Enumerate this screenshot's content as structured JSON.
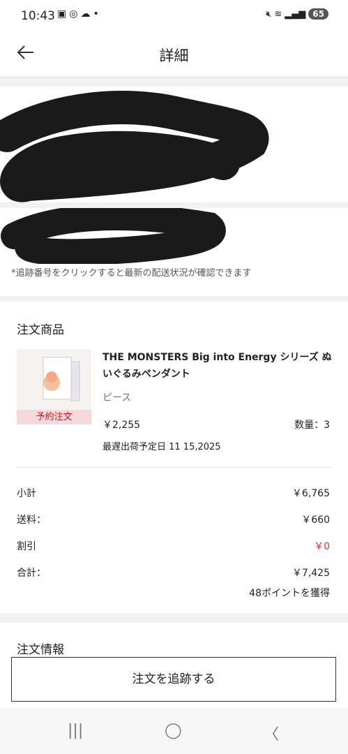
{
  "status_bar": {
    "time": "10:43",
    "battery": "65"
  },
  "header": {
    "title": "詳細"
  },
  "tracking_note": "*追跡番号をクリックすると最新の配送状況が確認できます",
  "order_items": {
    "section_title": "注文商品",
    "product": {
      "name": "THE MONSTERS Big into Energy シリーズ ぬいぐるみペンダント",
      "variant": "ピース",
      "price": "￥2,255",
      "quantity": "数量：3",
      "latest_ship_date": "最遅出荷予定日 11 15,2025",
      "badge": "予約注文"
    }
  },
  "summary": {
    "subtotal_label": "小計",
    "subtotal_value": "￥6,765",
    "shipping_label": "送料：",
    "shipping_value": "￥660",
    "discount_label": "割引",
    "discount_value": "￥0",
    "total_label": "合計：",
    "total_value": "￥7,425",
    "points": "48ポイントを獲得"
  },
  "order_info_title": "注文情報",
  "track_button": "注文を追跡する",
  "colors": {
    "discount": "#dd3333",
    "redaction": "#1a1a1a",
    "badge_bg": "#f7d9dc"
  }
}
